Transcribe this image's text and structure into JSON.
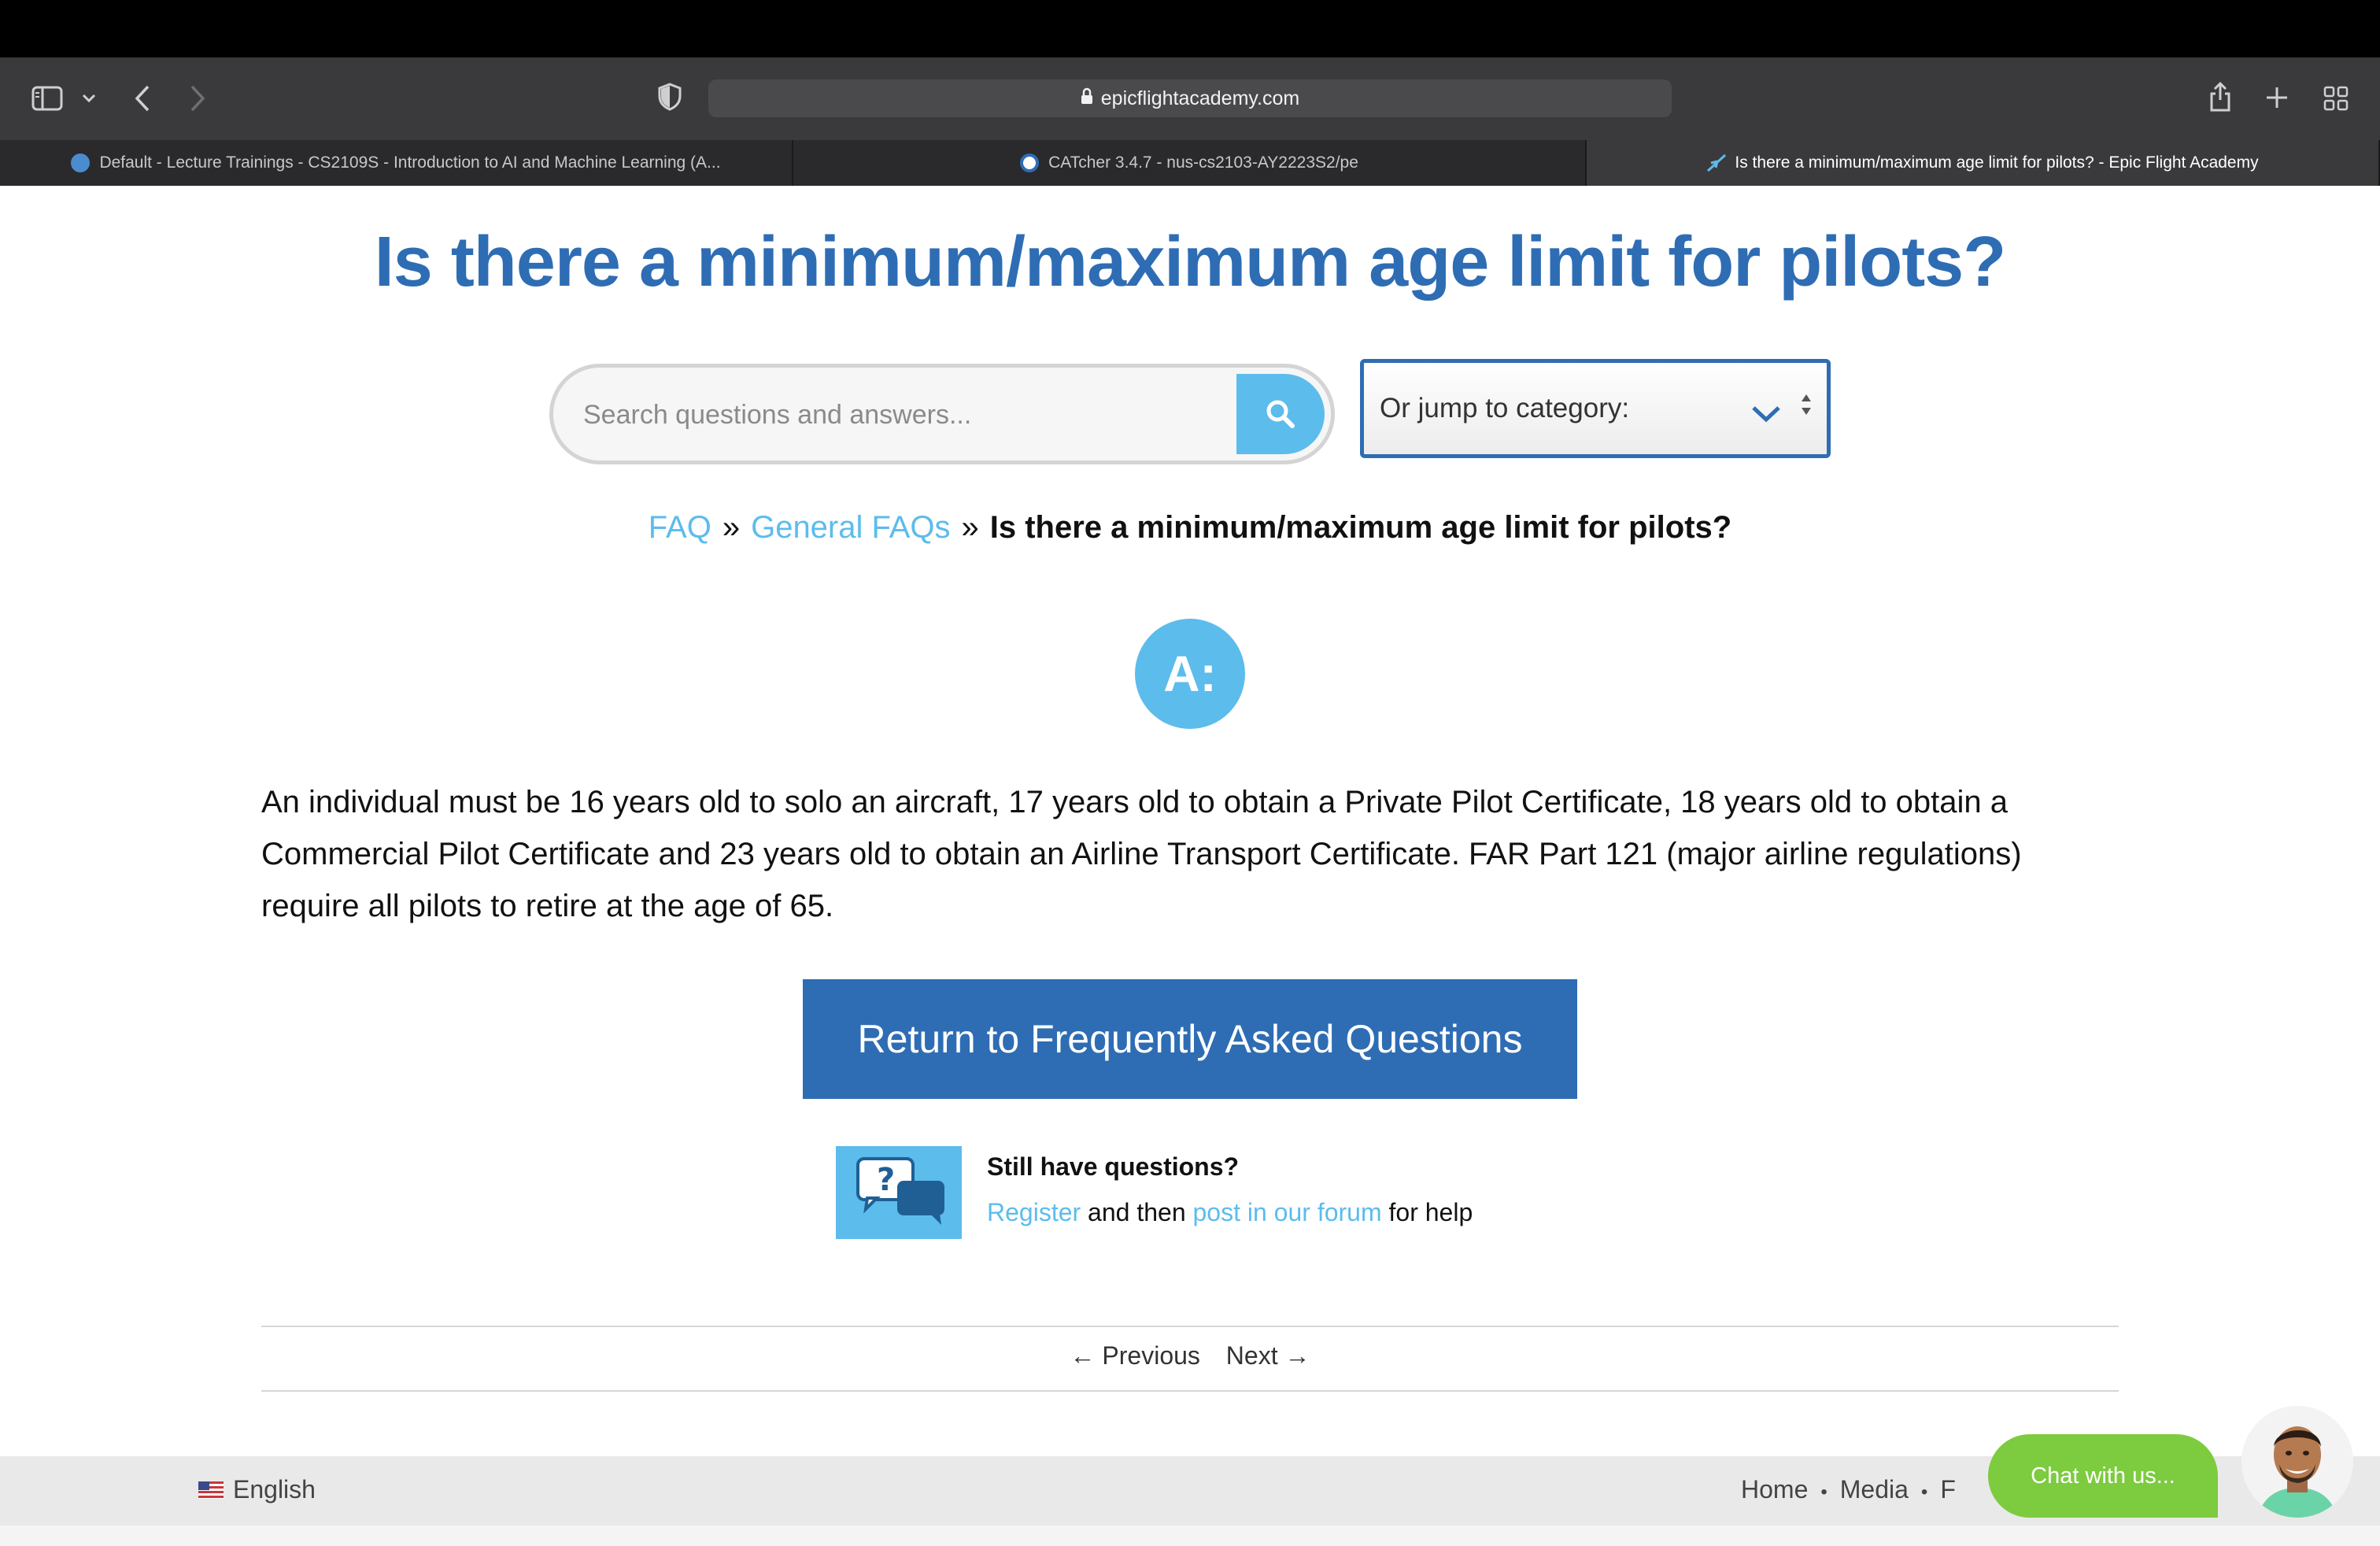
{
  "browser": {
    "url": "epicflightacademy.com",
    "tabs": [
      {
        "title": "Default - Lecture Trainings - CS2109S - Introduction to AI and Machine Learning (A...",
        "active": false
      },
      {
        "title": "CATcher 3.4.7 - nus-cs2103-AY2223S2/pe",
        "active": false
      },
      {
        "title": "Is there a minimum/maximum age limit for pilots? - Epic Flight Academy",
        "active": true
      }
    ]
  },
  "page": {
    "title": "Is there a minimum/maximum age limit for pilots?",
    "search_placeholder": "Search questions and answers...",
    "category_select": "Or jump to category:",
    "breadcrumb": {
      "faq": "FAQ",
      "sep": "»",
      "general": "General FAQs",
      "current": "Is there a minimum/maximum age limit for pilots?"
    },
    "answer_badge": "A:",
    "answer_text": "An individual must be 16 years old to solo an aircraft, 17 years old to obtain a Private Pilot Certificate, 18 years old to obtain a Commercial Pilot Certificate and 23 years old to obtain an Airline Transport Certificate.  FAR Part 121 (major airline regulations) require all pilots to retire at the age of 65.",
    "return_button": "Return to Frequently Asked Questions",
    "help": {
      "title": "Still have questions?",
      "register": "Register",
      "and_then": " and then ",
      "forum": "post in our forum",
      "for_help": " for help"
    },
    "pager": {
      "previous": "Previous",
      "next": "Next"
    }
  },
  "footer": {
    "language": "English",
    "nav": [
      "Home",
      "Media",
      "F"
    ],
    "nav_sep": "•"
  },
  "chat": {
    "label": "Chat with us..."
  },
  "colors": {
    "primary": "#2e6db4",
    "accent": "#5cbcec",
    "chat": "#7dcb3f"
  }
}
